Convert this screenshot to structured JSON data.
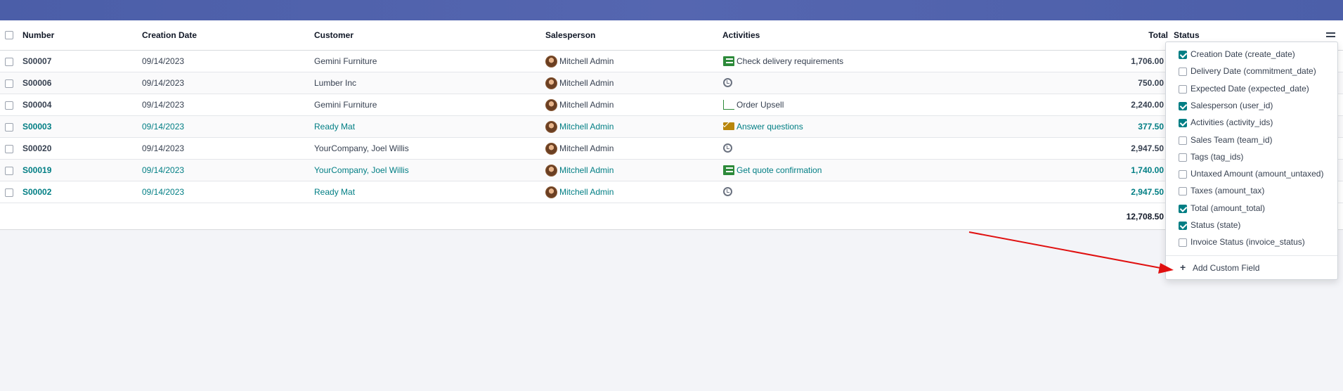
{
  "columns": {
    "number": "Number",
    "creation_date": "Creation Date",
    "customer": "Customer",
    "salesperson": "Salesperson",
    "activities": "Activities",
    "total": "Total",
    "status": "Status"
  },
  "rows": [
    {
      "number": "S00007",
      "date": "09/14/2023",
      "customer": "Gemini Furniture",
      "salesperson": "Mitchell Admin",
      "activity_icon": "list-icon",
      "activity": "Check delivery requirements",
      "total": "1,706.00"
    },
    {
      "number": "S00006",
      "date": "09/14/2023",
      "customer": "Lumber Inc",
      "salesperson": "Mitchell Admin",
      "activity_icon": "clock-icon",
      "activity": "",
      "total": "750.00"
    },
    {
      "number": "S00004",
      "date": "09/14/2023",
      "customer": "Gemini Furniture",
      "salesperson": "Mitchell Admin",
      "activity_icon": "chart-icon",
      "activity": "Order Upsell",
      "total": "2,240.00"
    },
    {
      "number": "S00003",
      "date": "09/14/2023",
      "customer": "Ready Mat",
      "salesperson": "Mitchell Admin",
      "activity_icon": "mail-icon",
      "activity": "Answer questions",
      "total": "377.50"
    },
    {
      "number": "S00020",
      "date": "09/14/2023",
      "customer": "YourCompany, Joel Willis",
      "salesperson": "Mitchell Admin",
      "activity_icon": "clock-icon",
      "activity": "",
      "total": "2,947.50"
    },
    {
      "number": "S00019",
      "date": "09/14/2023",
      "customer": "YourCompany, Joel Willis",
      "salesperson": "Mitchell Admin",
      "activity_icon": "list-icon",
      "activity": "Get quote confirmation",
      "total": "1,740.00"
    },
    {
      "number": "S00002",
      "date": "09/14/2023",
      "customer": "Ready Mat",
      "salesperson": "Mitchell Admin",
      "activity_icon": "clock-icon",
      "activity": "",
      "total": "2,947.50"
    }
  ],
  "grand_total": "12,708.50",
  "optional_columns": [
    {
      "label": "Creation Date (create_date)",
      "checked": true
    },
    {
      "label": "Delivery Date (commitment_date)",
      "checked": false
    },
    {
      "label": "Expected Date (expected_date)",
      "checked": false
    },
    {
      "label": "Salesperson (user_id)",
      "checked": true
    },
    {
      "label": "Activities (activity_ids)",
      "checked": true
    },
    {
      "label": "Sales Team (team_id)",
      "checked": false
    },
    {
      "label": "Tags (tag_ids)",
      "checked": false
    },
    {
      "label": "Untaxed Amount (amount_untaxed)",
      "checked": false
    },
    {
      "label": "Taxes (amount_tax)",
      "checked": false
    },
    {
      "label": "Total (amount_total)",
      "checked": true
    },
    {
      "label": "Status (state)",
      "checked": true
    },
    {
      "label": "Invoice Status (invoice_status)",
      "checked": false
    }
  ],
  "add_custom_field": "Add Custom Field",
  "colors": {
    "accent": "#017e84",
    "topbar": "#4b5ea8",
    "annotation_arrow": "#e01010"
  }
}
